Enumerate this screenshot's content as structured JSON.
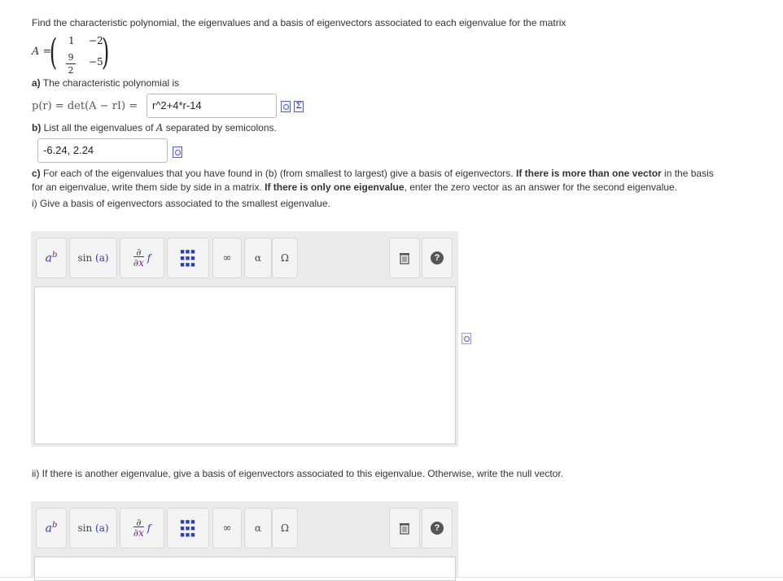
{
  "question": {
    "intro": "Find the characteristic polynomial, the eigenvalues and a basis of eigenvectors associated to each eigenvalue for the matrix",
    "matrix": {
      "lhs": "A =",
      "r1c1": "1",
      "r1c2": "−2",
      "r2c1_num": "9",
      "r2c1_den": "2",
      "r2c2": "−5"
    }
  },
  "part_a": {
    "prefix": "a)",
    "text": " The characteristic polynomial is",
    "equation": "p(r) = det(A − rI) =",
    "answer": "r^2+4*r-14"
  },
  "part_b": {
    "prefix": "b)",
    "text_before": " List all the eigenvalues of ",
    "var": "A",
    "text_after": " separated by semicolons.",
    "answer": "-6.24, 2.24"
  },
  "part_c": {
    "prefix": "c)",
    "t1": " For each of the eigenvalues that you have found in (b) (from smallest to largest) give a basis of eigenvectors. ",
    "b1": "If there is more than one vector",
    "t2": " in the basis for an eigenvalue, write them side by side in a matrix. ",
    "b2": "If there is only one eigenvalue",
    "t3": ", enter the zero vector as an answer for the second eigenvalue.",
    "i": "i) Give a basis of eigenvectors associated to the smallest eigenvalue.",
    "ii": "ii) If there is another eigenvalue, give a basis of eigenvectors associated to this eigenvalue. Otherwise, write the null vector."
  },
  "toolbar": {
    "sin_label": "sin",
    "sin_arg": "(a)",
    "infinity": "∞",
    "alpha": "α",
    "omega": "Ω",
    "help": "?"
  },
  "icons": {
    "preview": "preview-icon",
    "equation_editor": "sigma-icon",
    "trash": "trash-icon",
    "help": "help-icon"
  }
}
